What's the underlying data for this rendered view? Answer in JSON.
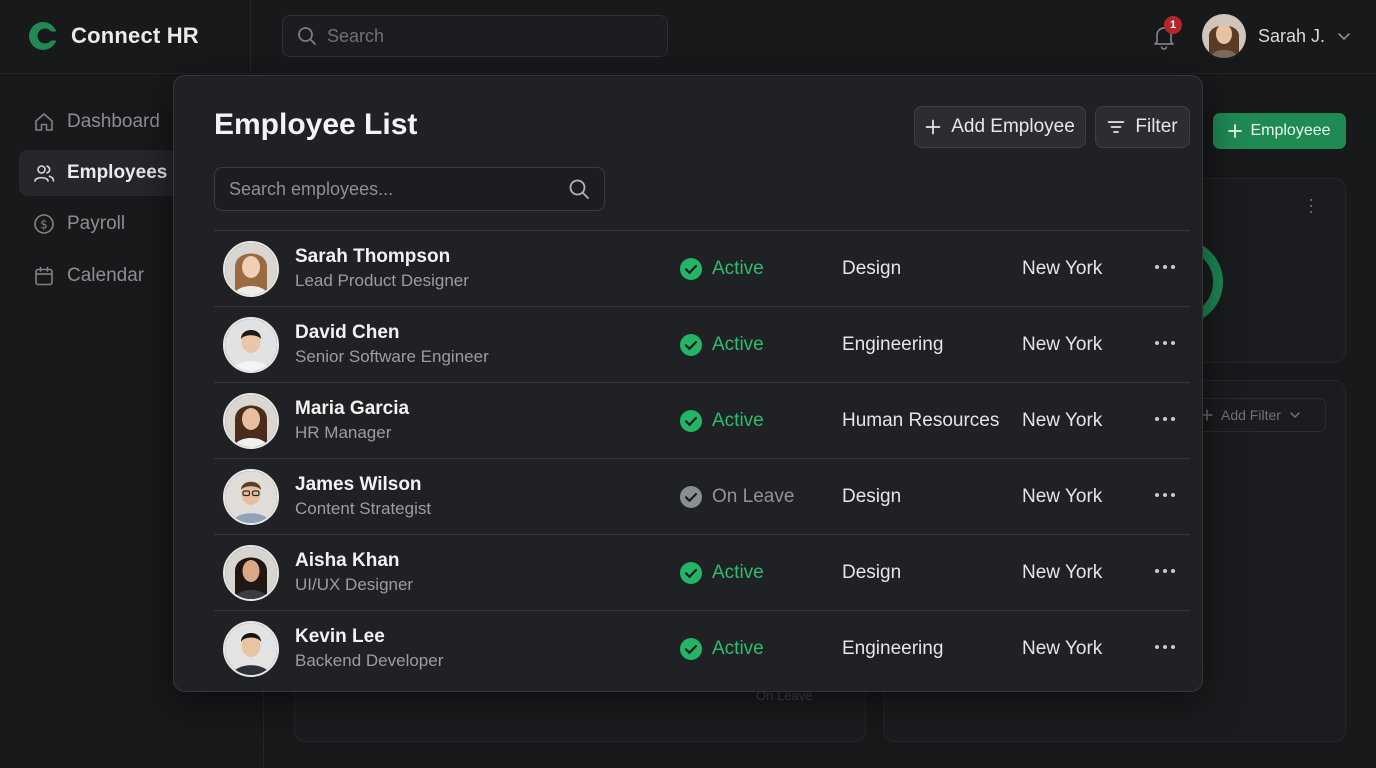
{
  "app": {
    "name": "Connect HR"
  },
  "header": {
    "search_placeholder": "Search",
    "notifications_count": "1",
    "user_name": "Sarah J."
  },
  "sidebar": {
    "items": [
      {
        "label": "Dashboard",
        "icon": "home-icon"
      },
      {
        "label": "Employees",
        "icon": "users-icon",
        "active": true
      },
      {
        "label": "Payroll",
        "icon": "dollar-circle-icon"
      },
      {
        "label": "Calendar",
        "icon": "calendar-icon"
      }
    ]
  },
  "background": {
    "add_button": "Employeee",
    "add_filter": "Add Filter",
    "status_label": "On Leave"
  },
  "modal": {
    "title": "Employee List",
    "add_button": "Add Employee",
    "filter_button": "Filter",
    "search_placeholder": "Search employees...",
    "employees": [
      {
        "name": "Sarah Thompson",
        "role": "Lead Product Designer",
        "status": "Active",
        "department": "Design",
        "location": "New York"
      },
      {
        "name": "David Chen",
        "role": "Senior Software Engineer",
        "status": "Active",
        "department": "Engineering",
        "location": "New York"
      },
      {
        "name": "Maria Garcia",
        "role": "HR Manager",
        "status": "Active",
        "department": "Human Resources",
        "location": "New York"
      },
      {
        "name": "James Wilson",
        "role": "Content Strategist",
        "status": "On Leave",
        "department": "Design",
        "location": "New York"
      },
      {
        "name": "Aisha Khan",
        "role": "UI/UX Designer",
        "status": "Active",
        "department": "Design",
        "location": "New York"
      },
      {
        "name": "Kevin Lee",
        "role": "Backend Developer",
        "status": "Active",
        "department": "Engineering",
        "location": "New York"
      }
    ]
  },
  "colors": {
    "accent": "#1f8a54",
    "active_status": "#2dbd6e",
    "leave_status": "#8f9297",
    "badge": "#b3262c"
  }
}
